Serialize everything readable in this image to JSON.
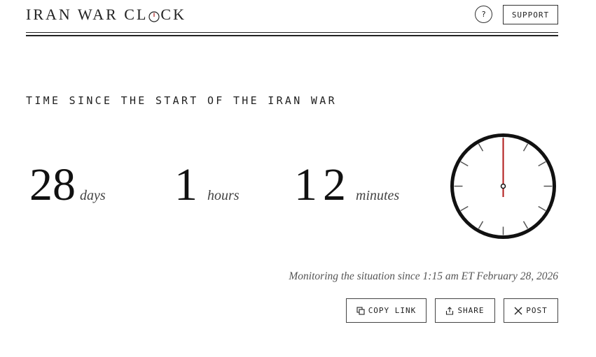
{
  "header": {
    "logo_left": "IRAN WAR CL",
    "logo_right": "CK",
    "help_label": "?",
    "support_label": "SUPPORT"
  },
  "main": {
    "heading": "TIME SINCE THE START OF THE IRAN WAR",
    "counter": {
      "days_value": "28",
      "days_label": "days",
      "hours_value": "1",
      "hours_label": "hours",
      "minutes_value": "12",
      "minutes_label": "minutes"
    },
    "clock": {
      "hour_hand_position": "12",
      "hand_color": "#b01a1a"
    }
  },
  "footer": {
    "monitoring_text": "Monitoring the situation since 1:15 am ET February 28, 2026",
    "copy_link_label": "COPY LINK",
    "share_label": "SHARE",
    "post_label": "POST"
  },
  "colors": {
    "ink": "#1a1a1a",
    "accent": "#b01a1a",
    "muted": "#555555"
  }
}
